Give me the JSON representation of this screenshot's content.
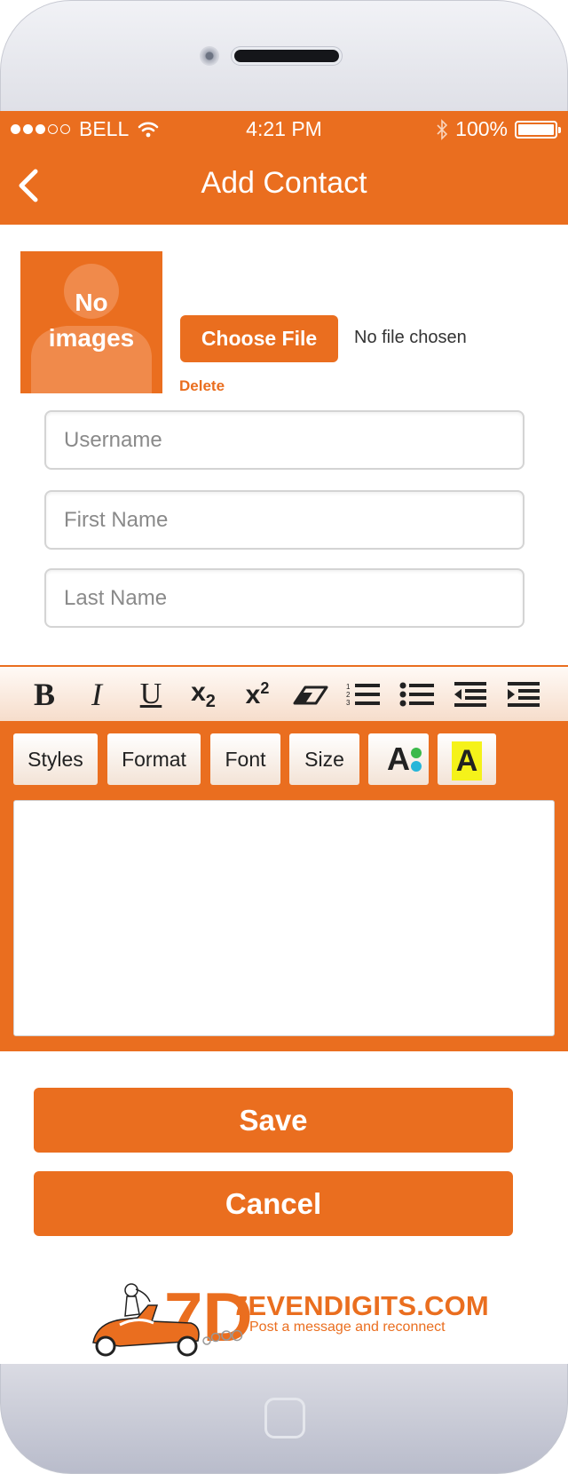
{
  "status_bar": {
    "carrier": "BELL",
    "time": "4:21 PM",
    "battery": "100%"
  },
  "nav": {
    "title": "Add Contact"
  },
  "avatar": {
    "line1": "No",
    "line2": "images"
  },
  "file": {
    "choose_label": "Choose File",
    "status": "No file chosen",
    "delete_label": "Delete"
  },
  "form": {
    "username_placeholder": "Username",
    "firstname_placeholder": "First Name",
    "lastname_placeholder": "Last Name"
  },
  "editor": {
    "toolbar_icons": [
      "bold-icon",
      "italic-icon",
      "underline-icon",
      "subscript-icon",
      "superscript-icon",
      "remove-format-icon",
      "numbered-list-icon",
      "bullet-list-icon",
      "outdent-icon",
      "indent-icon"
    ],
    "styles_label": "Styles",
    "format_label": "Format",
    "font_label": "Font",
    "size_label": "Size",
    "text_color_glyph": "A",
    "bg_color_glyph": "A"
  },
  "actions": {
    "save_label": "Save",
    "cancel_label": "Cancel"
  },
  "footer": {
    "brand": "7EVENDIGITS.COM",
    "tagline": "Post a message and reconnect",
    "logo_mark": "7D"
  },
  "colors": {
    "accent": "#ea6e1f",
    "highlight": "#f5f21a"
  }
}
